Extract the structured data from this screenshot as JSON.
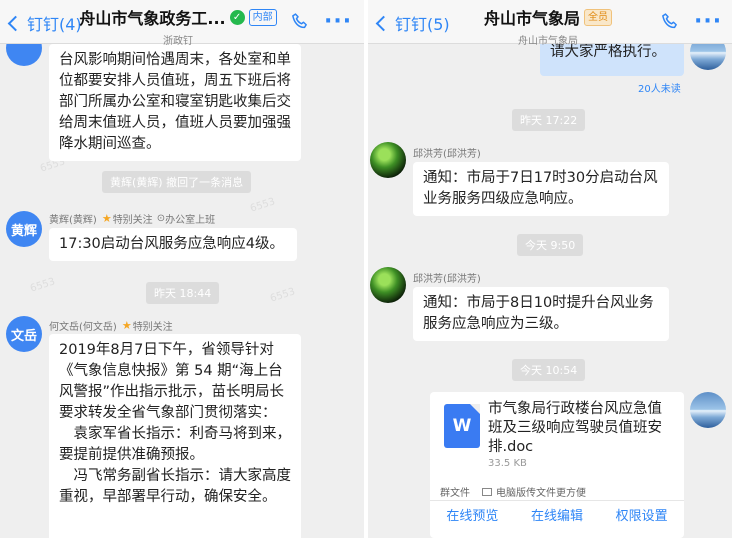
{
  "left": {
    "header": {
      "back_label": "钉钉(4)",
      "title": "舟山市气象政务工...",
      "verified_mark": "✓",
      "badge": "内部",
      "subtitle": "浙政钉"
    },
    "messages": {
      "m1": "台风影响期间恰遇周末，各处室和单位都要安排人员值班，周五下班后将部门所属办公室和寝室钥匙收集后交给周末值班人员，值班人员要加强强降水期间巡查。",
      "recall": "黄辉(黄辉) 撤回了一条消息",
      "m2_sender": "黄辉(黄辉)",
      "m2_avatar": "黄辉",
      "m2_follow": "特别关注",
      "m2_status": "办公室上班",
      "m2_text": "17:30启动台风服务应急响应4级。",
      "time1": "昨天 18:44",
      "m3_sender": "何文岳(何文岳)",
      "m3_avatar": "文岳",
      "m3_follow": "特别关注",
      "m3_p1": "2019年8月7日下午，省领导针对《气象信息快报》第 54 期“海上台风警报”作出指示批示，苗长明局长要求转发全省气象部门贯彻落实：",
      "m3_p2": "袁家军省长指示：利奇马将到来，要提前提供准确预报。",
      "m3_p3": "冯飞常务副省长指示：请大家高度重视，早部署早行动，确保安全。"
    },
    "watermark": "6553"
  },
  "right": {
    "header": {
      "back_label": "钉钉(5)",
      "title": "舟山市气象局",
      "badge": "全员",
      "subtitle": "舟山市气象局"
    },
    "messages": {
      "self_text": "请大家严格执行。",
      "read_count": "20人未读",
      "time1": "昨天 17:22",
      "sender1": "邱洪芳(邱洪芳)",
      "msg1": "通知：市局于7日17时30分启动台风业务服务四级应急响应。",
      "time2": "今天 9:50",
      "sender2": "邱洪芳(邱洪芳)",
      "msg2": "通知：市局于8日10时提升台风业务服务应急响应为三级。",
      "time3": "今天 10:54"
    },
    "file": {
      "icon_letter": "W",
      "name": "市气象局行政楼台风应急值班及三级响应驾驶员值班安排.doc",
      "size": "33.5 KB",
      "source": "群文件",
      "pc_note": "电脑版传文件更方便",
      "actions": [
        "在线预览",
        "在线编辑",
        "权限设置"
      ]
    }
  },
  "colors": {
    "accent": "#2f86f6",
    "background": "#efefef",
    "self_bubble": "#cfe3fb"
  }
}
